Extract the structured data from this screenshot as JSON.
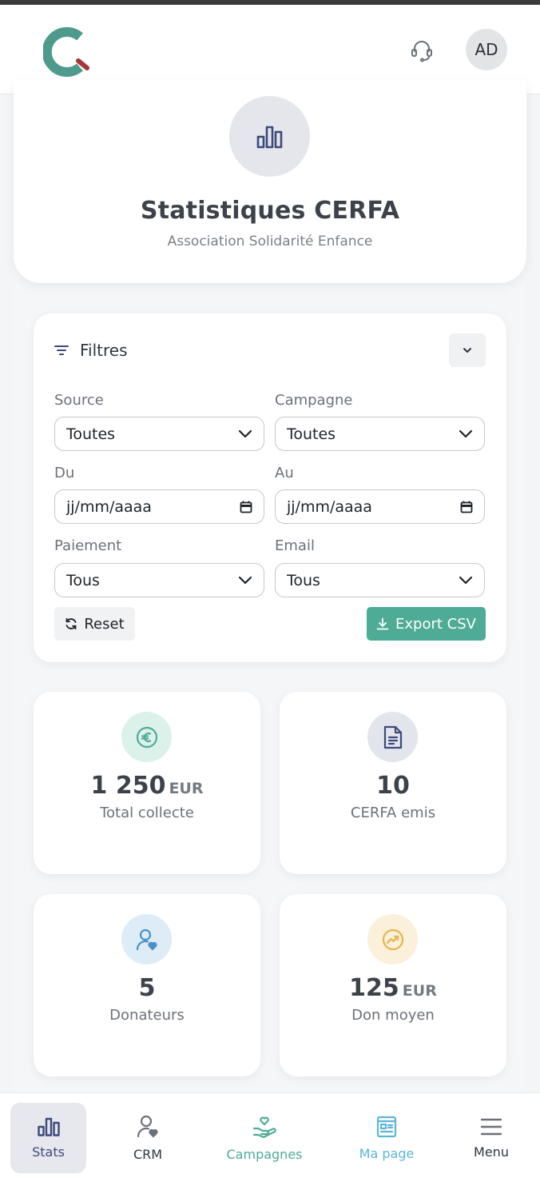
{
  "header": {
    "logo_icon": "c-logo",
    "support_icon": "headset-icon",
    "avatar_initials": "AD"
  },
  "hero": {
    "icon": "bar-chart-icon",
    "title": "Statistiques CERFA",
    "subtitle": "Association Solidarité Enfance"
  },
  "filters": {
    "title": "Filtres",
    "source": {
      "label": "Source",
      "value": "Toutes"
    },
    "campagne": {
      "label": "Campagne",
      "value": "Toutes"
    },
    "du": {
      "label": "Du",
      "placeholder": "jj/mm/aaaa"
    },
    "au": {
      "label": "Au",
      "placeholder": "jj/mm/aaaa"
    },
    "paiement": {
      "label": "Paiement",
      "value": "Tous"
    },
    "email": {
      "label": "Email",
      "value": "Tous"
    },
    "reset_label": "Reset",
    "export_label": "Export CSV"
  },
  "stats": {
    "total": {
      "value": "1 250",
      "unit": "EUR",
      "label": "Total collecte",
      "color": "#4eab96"
    },
    "cerfa": {
      "value": "10",
      "label": "CERFA emis",
      "color": "#3d4a7a"
    },
    "donateurs": {
      "value": "5",
      "label": "Donateurs",
      "color": "#4a90c8"
    },
    "moyen": {
      "value": "125",
      "unit": "EUR",
      "label": "Don moyen",
      "color": "#e7b451"
    }
  },
  "nav": {
    "stats": "Stats",
    "crm": "CRM",
    "campagnes": "Campagnes",
    "mapage": "Ma page",
    "menu": "Menu"
  },
  "colors": {
    "brand_green": "#4eab96",
    "brand_navy": "#3d4a7a",
    "light_blue": "#5bb6d6"
  }
}
